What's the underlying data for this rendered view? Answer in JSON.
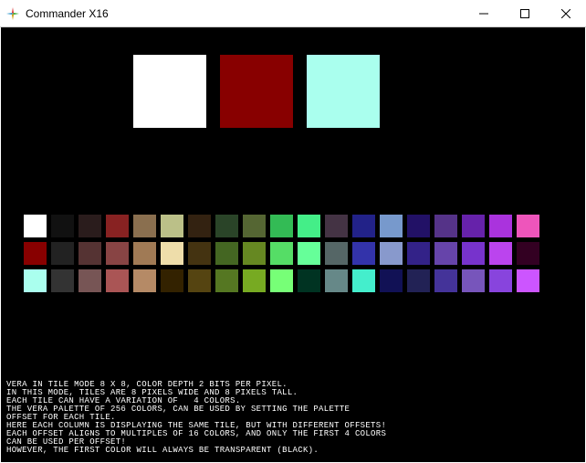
{
  "window": {
    "title": "Commander X16"
  },
  "big_swatches": [
    {
      "name": "white",
      "color": "#FFFFFF"
    },
    {
      "name": "dark-red",
      "color": "#880000"
    },
    {
      "name": "pale-cyan",
      "color": "#AAFFEE"
    }
  ],
  "palette_rows": [
    [
      "#FFFFFF",
      "#111111",
      "#2A1C1C",
      "#882222",
      "#8A6F4F",
      "#BBC088",
      "#332211",
      "#2A4428",
      "#556633",
      "#33BB55",
      "#44EE88",
      "#443344",
      "#222288",
      "#7799CC",
      "#221166",
      "#553388",
      "#6622AA",
      "#AA33DD",
      "#EE55BB"
    ],
    [
      "#880000",
      "#222222",
      "#553333",
      "#884444",
      "#A07A55",
      "#EEDDAA",
      "#443311",
      "#446622",
      "#668822",
      "#55DD66",
      "#66FF99",
      "#556666",
      "#3333AA",
      "#8899CC",
      "#332288",
      "#6644AA",
      "#7733CC",
      "#BB44EE",
      "#330022"
    ],
    [
      "#AAFFEE",
      "#333333",
      "#775555",
      "#AA5555",
      "#B58A66",
      "#332200",
      "#554411",
      "#557722",
      "#77AA22",
      "#77FF77",
      "#003322",
      "#668888",
      "#44EECC",
      "#111155",
      "#222255",
      "#443399",
      "#7755BB",
      "#8844DD",
      "#CC55FF"
    ]
  ],
  "text_lines": [
    "VERA IN TILE MODE 8 X 8, COLOR DEPTH 2 BITS PER PIXEL.",
    "IN THIS MODE, TILES ARE 8 PIXELS WIDE AND 8 PIXELS TALL.",
    "EACH TILE CAN HAVE A VARIATION OF   4 COLORS.",
    "THE VERA PALETTE OF 256 COLORS, CAN BE USED BY SETTING THE PALETTE",
    "OFFSET FOR EACH TILE.",
    "HERE EACH COLUMN IS DISPLAYING THE SAME TILE, BUT WITH DIFFERENT OFFSETS!",
    "EACH OFFSET ALIGNS TO MULTIPLES OF 16 COLORS, AND ONLY THE FIRST 4 COLORS",
    "CAN BE USED PER OFFSET!",
    "HOWEVER, THE FIRST COLOR WILL ALWAYS BE TRANSPARENT (BLACK)."
  ]
}
